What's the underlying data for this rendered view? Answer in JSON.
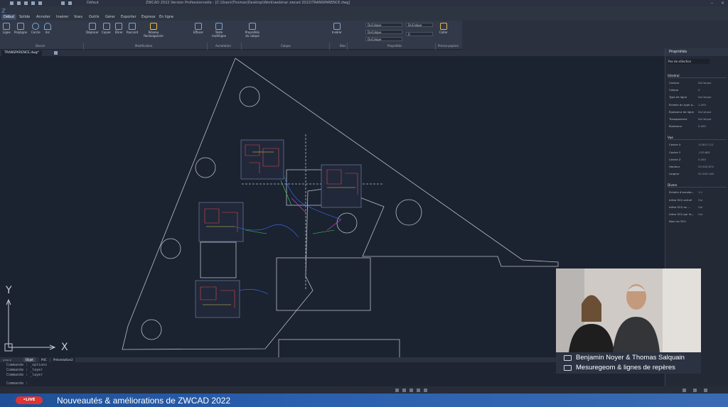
{
  "window": {
    "title": "ZWCAD 2022 Version Professionnelle - [C:\\Users\\Thomas\\Desktop\\Work\\webinar zwcad 2022\\TRANSPARENCE.dwg]",
    "workspace": "Défaut"
  },
  "menu": {
    "tabs": [
      "Début",
      "Solide",
      "Annoter",
      "Insérer",
      "Vues",
      "Outils",
      "Gérer",
      "Exporter",
      "Express",
      "En ligne"
    ],
    "active": "Début"
  },
  "ribbon": {
    "dessin": [
      "Ligne",
      "Polyligne",
      "Cercle",
      "Arc"
    ],
    "modification": [
      "Déplacer",
      "Copier",
      "Étirer",
      "Raccord",
      "Réseau Rectangulaire",
      "Effacer"
    ],
    "annotation": [
      "Texte multiligne"
    ],
    "calque": [
      "Propriétés du calque"
    ],
    "bloc": [
      "Insérer"
    ],
    "proprietes_combos": [
      "DuCalque",
      "DuCalque",
      "DuCalque",
      "DuCalque",
      "0"
    ],
    "presse": [
      "Coller"
    ],
    "groups": [
      "Dessin",
      "Modification",
      "Annotation",
      "Calque",
      "Bloc",
      "Propriétés",
      "Presse-papiers"
    ]
  },
  "document_tab": "TRANSPARENCE.dwg*",
  "axis_labels": {
    "y": "Y",
    "x": "X"
  },
  "properties": {
    "header": "Propriétés",
    "selection": "Pas de sélection",
    "sections": [
      {
        "title": "Général",
        "rows": [
          [
            "Couleur",
            "DuCalque"
          ],
          [
            "Calque",
            "0"
          ],
          [
            "Type de ligne",
            "DuCalque"
          ],
          [
            "Échelle du type d...",
            "1.000"
          ],
          [
            "Épaisseur de ligne",
            "DuCalque"
          ],
          [
            "Transparence",
            "DuCalque"
          ],
          [
            "Épaisseur",
            "0.000"
          ]
        ]
      },
      {
        "title": "Vue",
        "rows": [
          [
            "Centre X",
            "13 807.111"
          ],
          [
            "Centre Y",
            "-133.661"
          ],
          [
            "Centre Z",
            "0.000"
          ],
          [
            "Hauteur",
            "29 002.874"
          ],
          [
            "Largeur",
            "52 003.146"
          ]
        ]
      },
      {
        "title": "Divers",
        "rows": [
          [
            "Échelle d'annota...",
            "1:1"
          ],
          [
            "Icône SCU activé",
            "Oui"
          ],
          [
            "Icône SCU au ...",
            "Oui"
          ],
          [
            "Icône SCU par fe...",
            "Oui"
          ],
          [
            "Nom du SCU",
            ""
          ]
        ]
      }
    ]
  },
  "command_tabs": [
    "Objet",
    "PdC",
    "Présentation2"
  ],
  "command_lines": [
    "Commande : _options",
    "Commande : _layer",
    "Commande : _layer",
    "Commande :"
  ],
  "webcam_caption": {
    "line1": "Benjamin Noyer & Thomas Salquain",
    "line2": "Mesuregeom & lignes de repères"
  },
  "bottom_banner": {
    "badge": "•LIVE",
    "title": "Nouveautés & améliorations de ZWCAD 2022"
  },
  "colors": {
    "background": "#1b2230",
    "ribbon": "#323948",
    "banner": "#2a5fae",
    "live": "#e03333"
  }
}
